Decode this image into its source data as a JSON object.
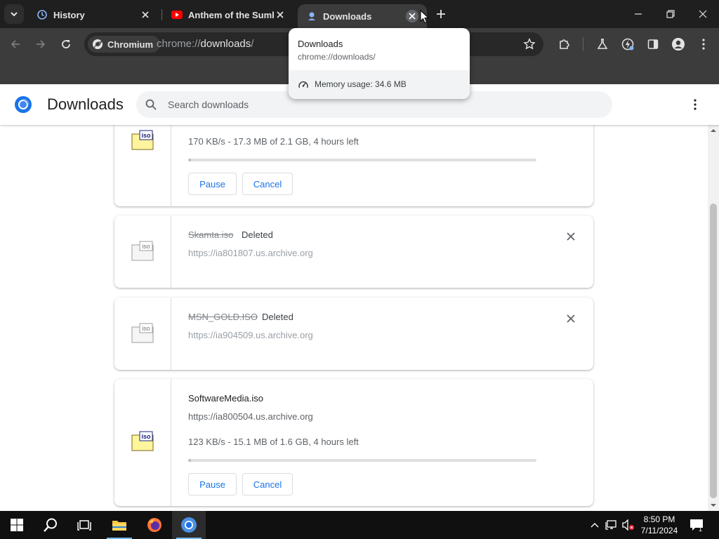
{
  "browser": {
    "tabs": [
      {
        "title": "History",
        "icon": "history-icon"
      },
      {
        "title": "Anthem of the Sumke",
        "icon": "youtube-icon"
      },
      {
        "title": "Downloads",
        "icon": "downloads-icon"
      }
    ],
    "chip_label": "Chromium",
    "url_scheme": "chrome://",
    "url_host": "downloads",
    "url_path": "/"
  },
  "hover_card": {
    "title": "Downloads",
    "url": "chrome://downloads/",
    "memory": "Memory usage: 34.6 MB"
  },
  "downloads_page": {
    "title": "Downloads",
    "search_placeholder": "Search downloads",
    "items": [
      {
        "progress_text": "170 KB/s - 17.3 MB of 2.1 GB, 4 hours left",
        "progress_fraction": 0.008,
        "pause_label": "Pause",
        "cancel_label": "Cancel"
      },
      {
        "filename": "Skamta.iso",
        "status": "Deleted",
        "url": "https://ia801807.us.archive.org"
      },
      {
        "filename": "MSN_GOLD.ISO",
        "status": "Deleted",
        "url": "https://ia904509.us.archive.org"
      },
      {
        "filename": "SoftwareMedia.iso",
        "url": "https://ia800504.us.archive.org",
        "progress_text": "123 KB/s - 15.1 MB of 1.6 GB, 4 hours left",
        "progress_fraction": 0.009,
        "pause_label": "Pause",
        "cancel_label": "Cancel"
      }
    ]
  },
  "taskbar": {
    "time": "8:50 PM",
    "date": "7/11/2024",
    "notifications": "1"
  },
  "colors": {
    "accent": "#1a73e8",
    "tabstrip": "#1f1f1f",
    "toolbar": "#3c3c3c",
    "taskbar": "#101010"
  }
}
